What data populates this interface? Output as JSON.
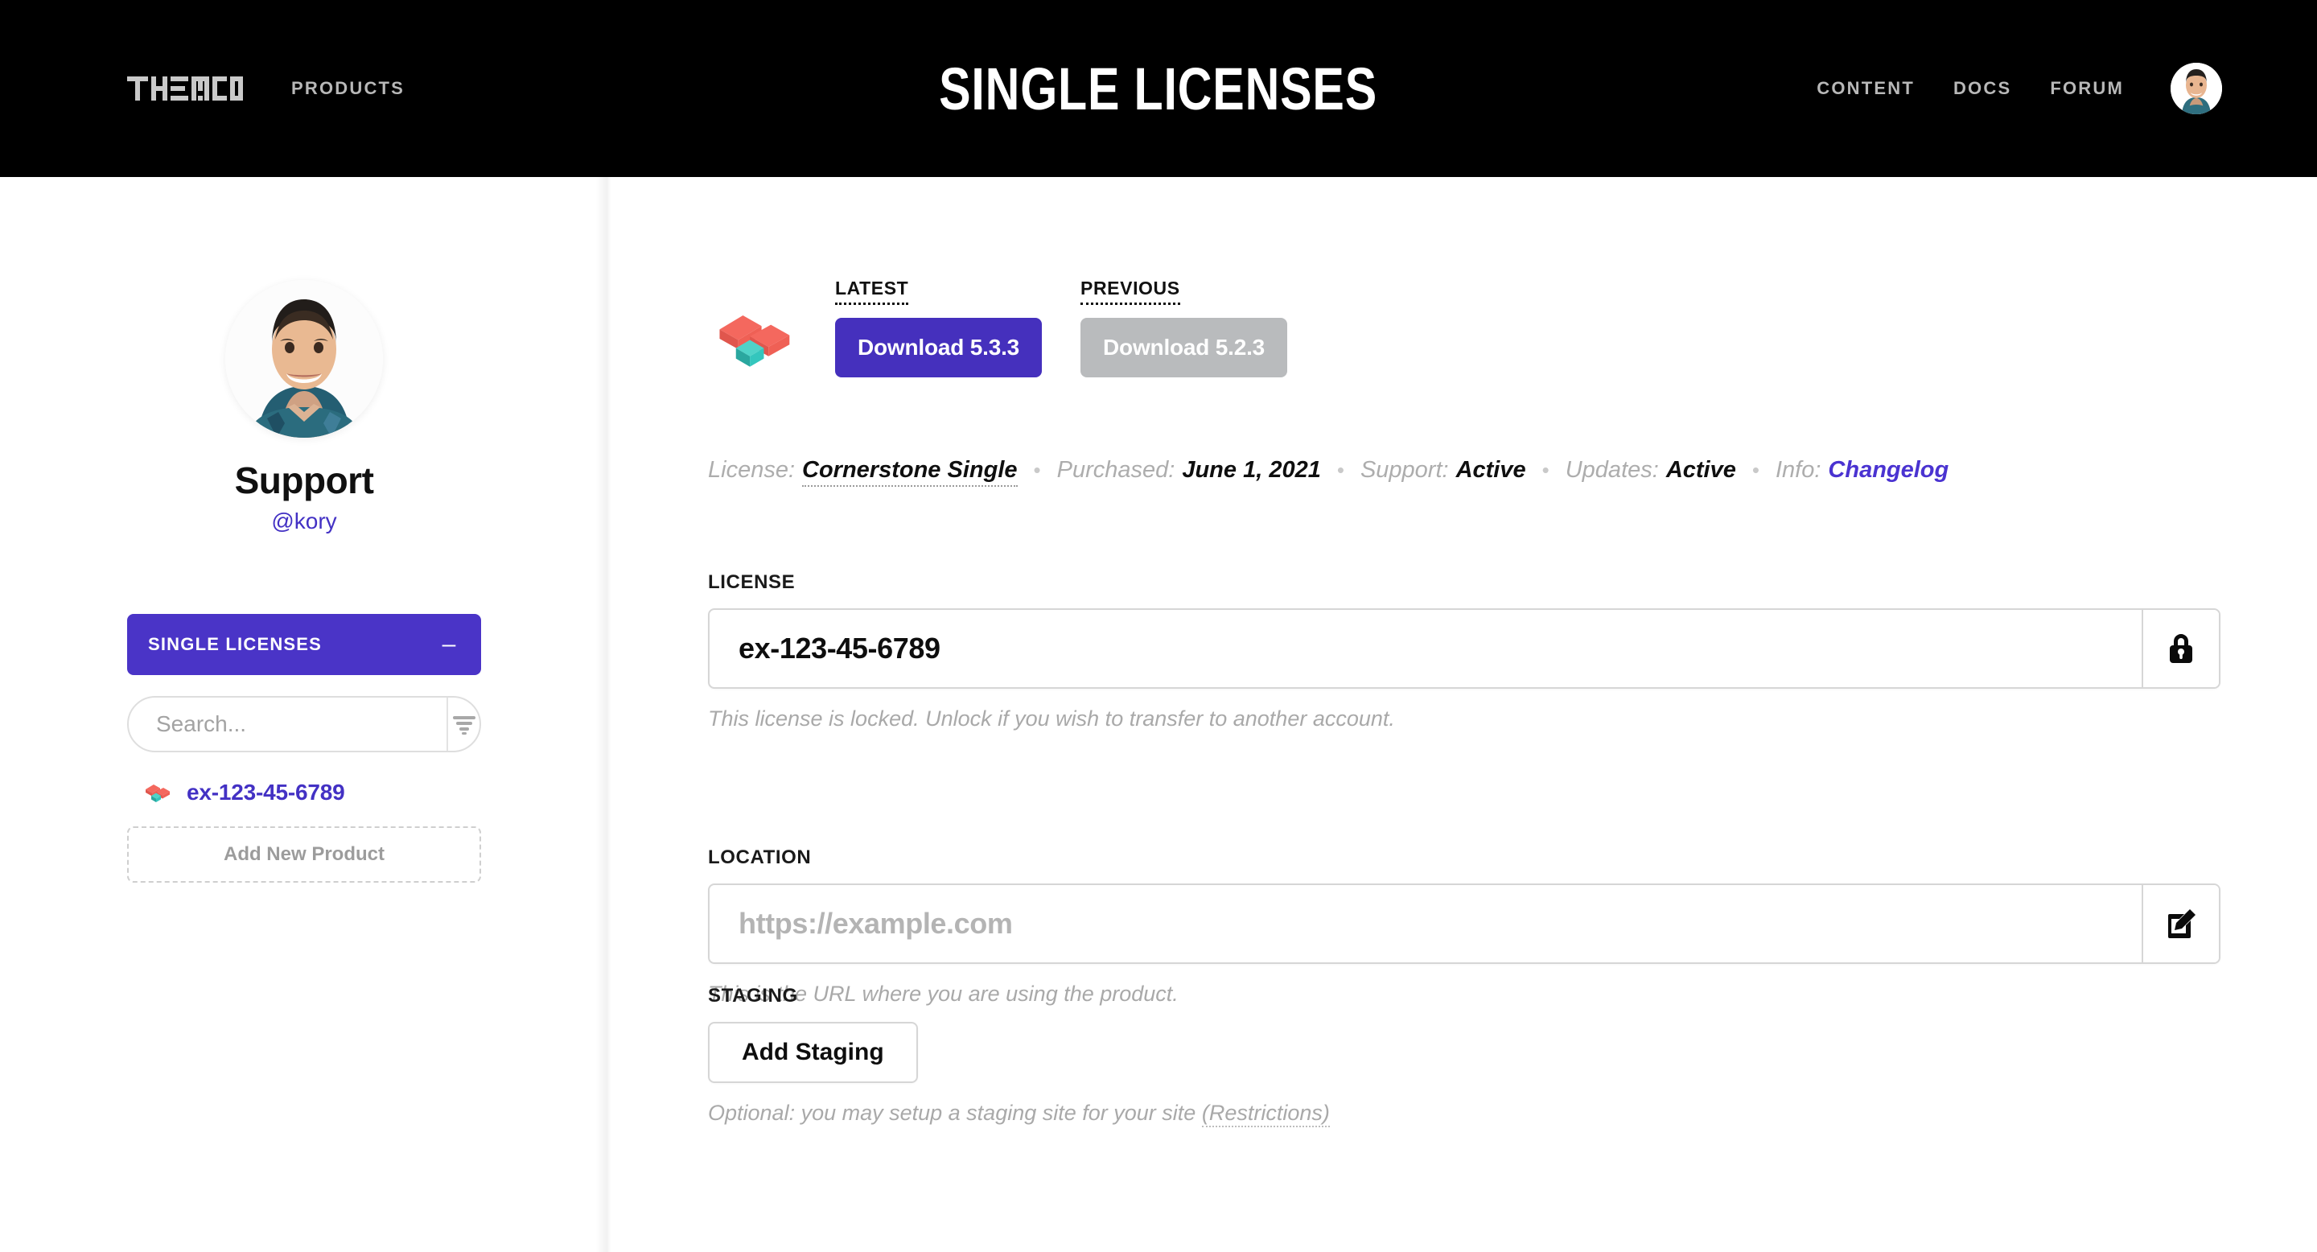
{
  "header": {
    "brand": "THEMECO",
    "brand_icon": "themeco-logo-icon",
    "nav_left": [
      {
        "label": "PRODUCTS"
      }
    ],
    "title": "SINGLE LICENSES",
    "nav_right": [
      {
        "label": "CONTENT"
      },
      {
        "label": "DOCS"
      },
      {
        "label": "FORUM"
      }
    ],
    "avatar_icon": "user-avatar"
  },
  "sidebar": {
    "profile": {
      "avatar_icon": "user-avatar",
      "name": "Support",
      "handle": "@kory"
    },
    "section": {
      "label": "SINGLE LICENSES",
      "toggle_icon": "minus-icon",
      "toggle_glyph": "–"
    },
    "search": {
      "value": "",
      "placeholder": "Search...",
      "filter_icon": "filter-icon"
    },
    "licenses": [
      {
        "icon": "cornerstone-product-icon",
        "label": "ex-123-45-6789"
      }
    ],
    "add_product_label": "Add New Product"
  },
  "main": {
    "product_icon": "cornerstone-product-icon",
    "downloads": [
      {
        "label": "LATEST",
        "button": "Download 5.3.3",
        "style": "primary"
      },
      {
        "label": "PREVIOUS",
        "button": "Download 5.2.3",
        "style": "muted"
      }
    ],
    "meta": [
      {
        "key": "License:",
        "value": "Cornerstone Single",
        "style": "dotted"
      },
      {
        "key": "Purchased:",
        "value": "June 1, 2021",
        "style": "plain"
      },
      {
        "key": "Support:",
        "value": "Active",
        "style": "plain"
      },
      {
        "key": "Updates:",
        "value": "Active",
        "style": "plain"
      },
      {
        "key": "Info:",
        "value": "Changelog",
        "style": "link"
      }
    ],
    "separator": "•",
    "license_field": {
      "label": "LICENSE",
      "value": "ex-123-45-6789",
      "placeholder": "",
      "action_icon": "lock-icon",
      "note": "This license is locked. Unlock if you wish to transfer to another account."
    },
    "location_field": {
      "label": "LOCATION",
      "value": "",
      "placeholder": "https://example.com",
      "action_icon": "edit-pencil-icon",
      "note": "This is the URL where you are using the product."
    },
    "staging_field": {
      "label": "STAGING",
      "button": "Add Staging",
      "note_prefix": "Optional: you may setup a staging site for your site ",
      "note_link": "(Restrictions)"
    }
  },
  "colors": {
    "accent_purple": "#4530bd",
    "sidebar_purple": "#4a34c7",
    "link_purple": "#4331c4",
    "muted_gray": "#b9bbbd",
    "header_black": "#000000",
    "product_red": "#f4685e",
    "product_teal": "#34c6bd"
  }
}
